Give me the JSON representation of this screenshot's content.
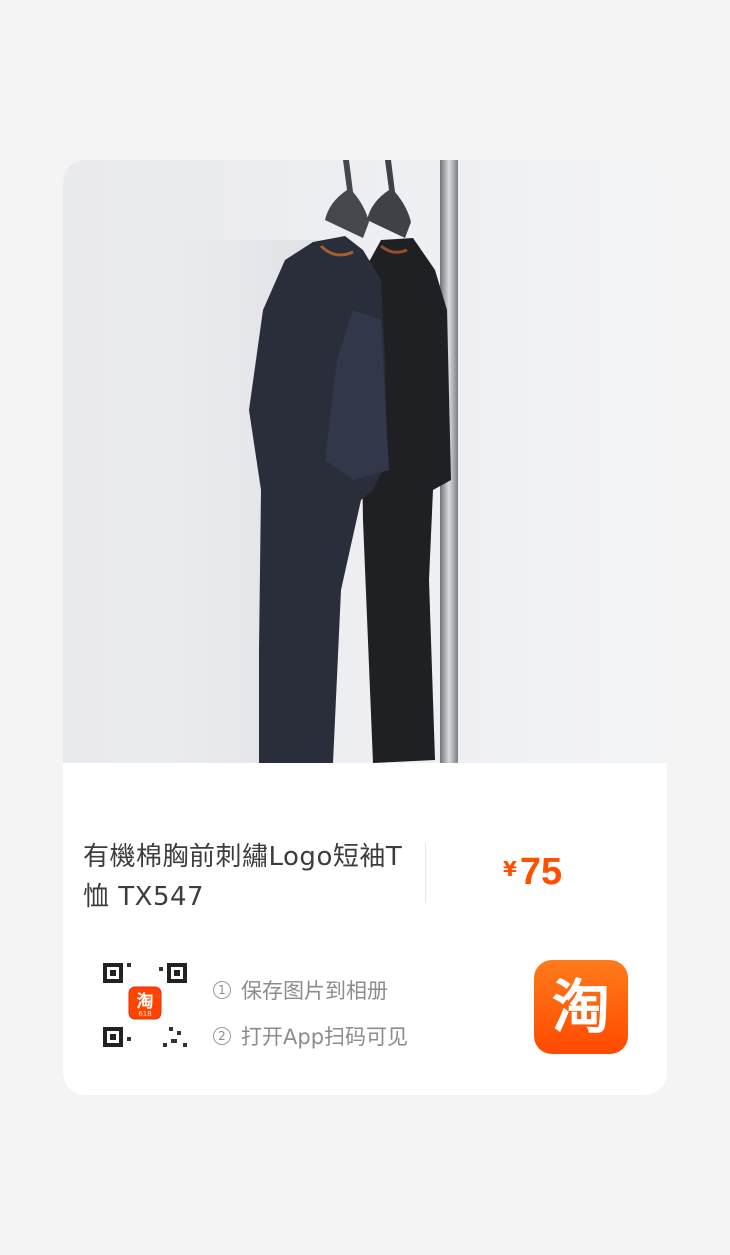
{
  "product": {
    "title": "有機棉胸前刺繡Logo短袖T恤 TX547",
    "currency": "¥",
    "price": "75",
    "image_icon": "tshirt-on-hanger-photo"
  },
  "share": {
    "steps": [
      {
        "num": "1",
        "label": "保存图片到相册"
      },
      {
        "num": "2",
        "label": "打开App扫码可见"
      }
    ],
    "qr_badge_text": "淘",
    "qr_badge_sub": "618",
    "app_logo_text": "淘"
  },
  "colors": {
    "price": "#ff5000",
    "logo": "#ff5000",
    "background": "#f4f4f4"
  }
}
